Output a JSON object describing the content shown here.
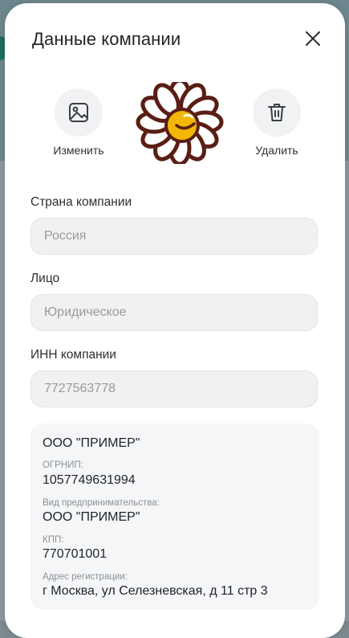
{
  "modal": {
    "title": "Данные компании",
    "close_icon": "close-icon"
  },
  "avatar": {
    "change_label": "Изменить",
    "change_icon": "image-icon",
    "delete_label": "Удалить",
    "delete_icon": "trash-icon",
    "logo": "daisy-logo"
  },
  "fields": {
    "country": {
      "label": "Страна компании",
      "placeholder": "Россия"
    },
    "entity": {
      "label": "Лицо",
      "placeholder": "Юридическое"
    },
    "inn": {
      "label": "ИНН компании",
      "placeholder": "7727563778"
    }
  },
  "company_info": {
    "name": "ООО \"ПРИМЕР\"",
    "ogrnip_label": "ОГРНИП:",
    "ogrnip_value": "1057749631994",
    "business_type_label": "Вид предпринимательства:",
    "business_type_value": "ООО \"ПРИМЕР\"",
    "kpp_label": "КПП:",
    "kpp_value": "770701001",
    "address_label": "Адрес регистрации:",
    "address_value": "г Москва, ул Селезневская, д 11 стр 3"
  },
  "colors": {
    "modal_bg": "#ffffff",
    "field_bg": "#f1f1f1",
    "card_bg": "#f5f6f7",
    "text": "#1f2328",
    "muted": "#8b9094",
    "logo_petal_outline": "#5a1e14",
    "logo_center": "#f2b705"
  }
}
